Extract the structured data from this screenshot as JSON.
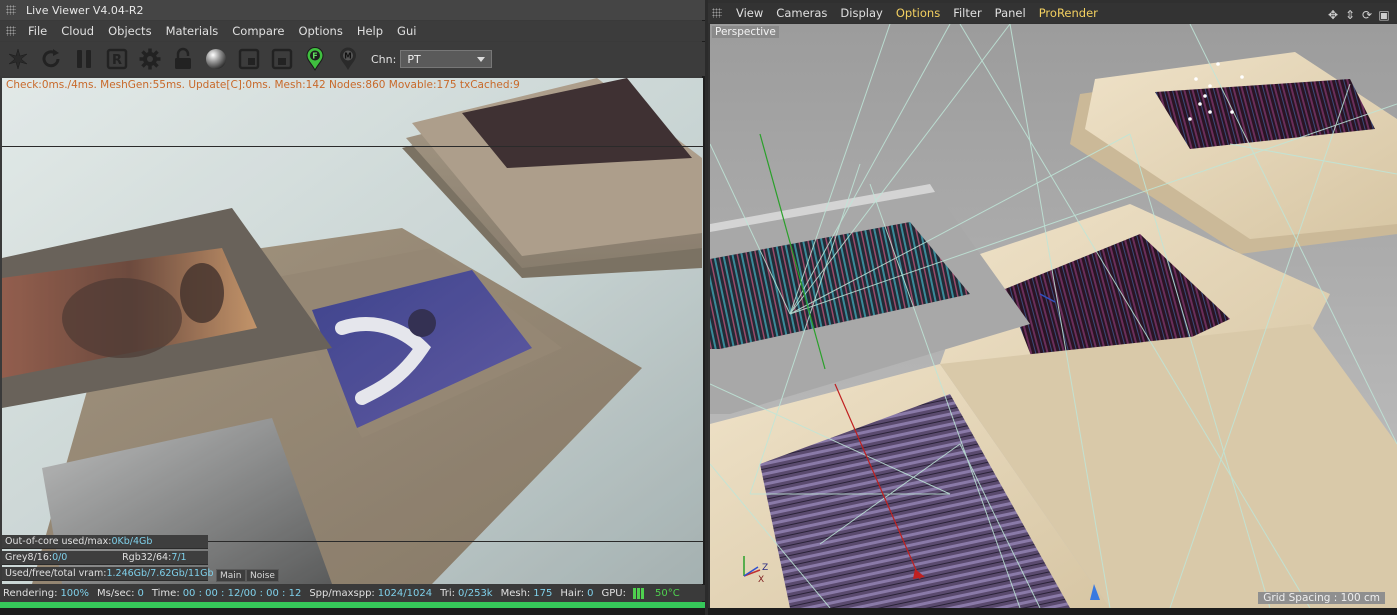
{
  "live_viewer": {
    "title": "Live Viewer V4.04-R2",
    "menu": [
      "File",
      "Cloud",
      "Objects",
      "Materials",
      "Compare",
      "Options",
      "Help",
      "Gui"
    ],
    "toolbar": {
      "icons": [
        "send-scene-icon",
        "restart-icon",
        "pause-icon",
        "region-render-icon",
        "settings-icon",
        "lock-icon",
        "material-ball-icon",
        "clay-mode-icon",
        "subsample-icon",
        "focus-pick-icon",
        "material-pick-icon"
      ],
      "focus_letter": "F",
      "material_letter": "M",
      "region_letter": "R",
      "channel_label": "Chn:",
      "channel_value": "PT"
    },
    "stats_line": "Check:0ms./4ms. MeshGen:55ms. Update[C]:0ms. Mesh:142 Nodes:860 Movable:175 txCached:9",
    "memory": {
      "out_of_core_label": "Out-of-core used/max:",
      "out_of_core_value": "0Kb/4Gb",
      "grey_label": "Grey8/16: ",
      "grey_value": "0/0",
      "rgb_label": "Rgb32/64: ",
      "rgb_value": "7/1",
      "vram_label": "Used/free/total vram: ",
      "vram_value": "1.246Gb/7.62Gb/11Gb"
    },
    "buttons": {
      "main": "Main",
      "noise": "Noise"
    },
    "status": {
      "rendering_label": "Rendering:",
      "rendering_value": "100%",
      "ms_label": "Ms/sec:",
      "ms_value": "0",
      "time_label": "Time:",
      "time_value": "00 : 00 : 12/00 : 00 : 12",
      "spp_label": "Spp/maxspp:",
      "spp_value": "1024/1024",
      "tri_label": "Tri:",
      "tri_value": "0/253k",
      "mesh_label": "Mesh:",
      "mesh_value": "175",
      "hair_label": "Hair:",
      "hair_value": "0",
      "gpu_label": "GPU:",
      "gpu_temp": "50°C"
    },
    "progress": 1.0
  },
  "c4d_viewport": {
    "menu": [
      "View",
      "Cameras",
      "Display",
      "Options",
      "Filter",
      "Panel",
      "ProRender"
    ],
    "highlighted": [
      "Options",
      "ProRender"
    ],
    "nav_icons": [
      "move-view-icon",
      "dolly-view-icon",
      "rotate-view-icon",
      "maximize-view-icon"
    ],
    "camera_label": "Perspective",
    "grid_spacing": "Grid Spacing : 100 cm",
    "axis_labels": {
      "z": "Z",
      "x": "X"
    }
  },
  "colors": {
    "stats_orange": "#c8692a",
    "value_cyan": "#7fd0ea",
    "progress_green": "#36c85a",
    "menu_highlight": "#f3d060"
  }
}
